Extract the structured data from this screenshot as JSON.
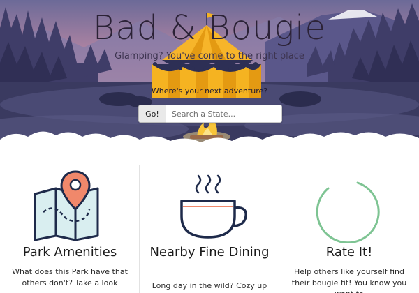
{
  "hero": {
    "title": "Bad & Bougie",
    "tagline": "Glamping? You've come to the right place",
    "search_prompt": "Where's your next adventure?",
    "go_label": "Go!",
    "search_placeholder": "Search a State..."
  },
  "colors": {
    "sky_top": "#6f6b9a",
    "sky_glow": "#e7a3a8",
    "mountains": "#4b4a78",
    "trees": "#3b3a62",
    "ground": "#2f3050",
    "tent_yellow": "#f5b321",
    "tent_navy": "#2d2f55",
    "fire": "#f8c53a",
    "map_blue": "#d9eef0",
    "pin": "#f0886b",
    "cup_navy": "#1e2a4a",
    "ring_green": "#7ec493"
  },
  "cards": [
    {
      "icon": "map-pin-icon",
      "title": "Park Amenities",
      "text": "What does this Park have that others don't? Take a look"
    },
    {
      "icon": "coffee-cup-icon",
      "title": "Nearby Fine Dining",
      "text": "Long day in the wild? Cozy up"
    },
    {
      "icon": "rating-ring-icon",
      "title": "Rate It!",
      "text": "Help others like yourself find their bougie fit! You know you want to"
    }
  ]
}
